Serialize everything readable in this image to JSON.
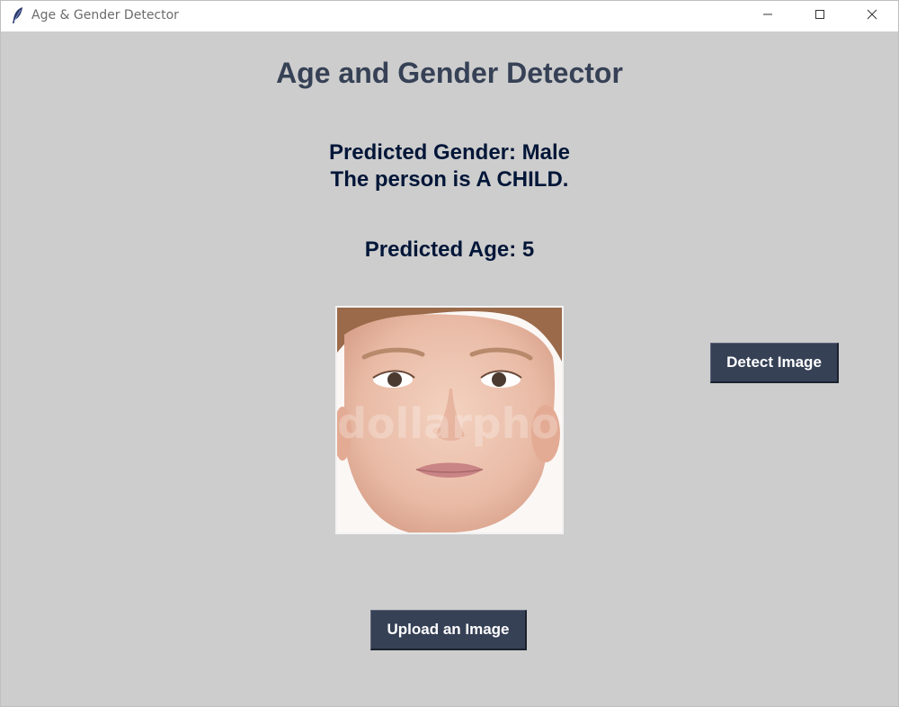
{
  "window": {
    "title": "Age & Gender Detector",
    "app_icon": "feather-icon",
    "controls": [
      "minimize-icon",
      "maximize-icon",
      "close-icon"
    ]
  },
  "main": {
    "heading": "Age and Gender Detector",
    "gender_line": "Predicted Gender: Male",
    "category_line": "The person is A CHILD.",
    "age_line": "Predicted Age: 5",
    "image": {
      "description": "uploaded-face-photo",
      "watermark": "dollarphoto"
    }
  },
  "buttons": {
    "detect_label": "Detect Image",
    "upload_label": "Upload an Image"
  },
  "colors": {
    "background": "#cdcdcd",
    "heading": "#364156",
    "result_text": "#011638",
    "button_bg": "#364156",
    "button_text": "#ffffff"
  }
}
